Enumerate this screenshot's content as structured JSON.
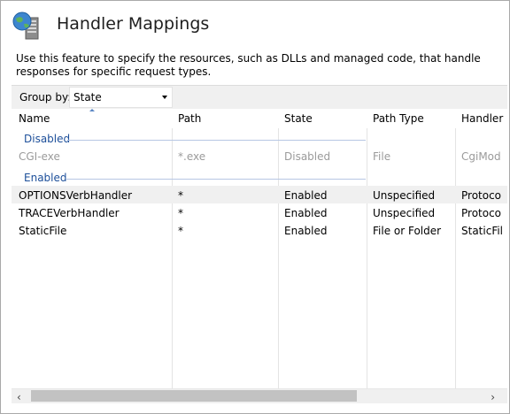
{
  "header": {
    "title": "Handler Mappings",
    "icon": "globe-server-icon"
  },
  "description": "Use this feature to specify the resources, such as DLLs and managed code, that handle responses for specific request types.",
  "toolbar": {
    "group_by_label": "Group by:",
    "group_by_value": "State"
  },
  "table": {
    "columns": [
      "Name",
      "Path",
      "State",
      "Path Type",
      "Handler"
    ],
    "groups": [
      {
        "label": "Disabled",
        "rows": [
          {
            "name": "CGI-exe",
            "path": "*.exe",
            "state": "Disabled",
            "path_type": "File",
            "handler": "CgiMod"
          }
        ]
      },
      {
        "label": "Enabled",
        "rows": [
          {
            "name": "OPTIONSVerbHandler",
            "path": "*",
            "state": "Enabled",
            "path_type": "Unspecified",
            "handler": "Protoco"
          },
          {
            "name": "TRACEVerbHandler",
            "path": "*",
            "state": "Enabled",
            "path_type": "Unspecified",
            "handler": "Protoco"
          },
          {
            "name": "StaticFile",
            "path": "*",
            "state": "Enabled",
            "path_type": "File or Folder",
            "handler": "StaticFil"
          }
        ]
      }
    ]
  },
  "scrollbar": {
    "left_arrow": "‹",
    "right_arrow": "›"
  },
  "colors": {
    "group_label": "#1d4f9a",
    "disabled_text": "#9b9b9b",
    "selected_row": "#f0f0f0"
  }
}
